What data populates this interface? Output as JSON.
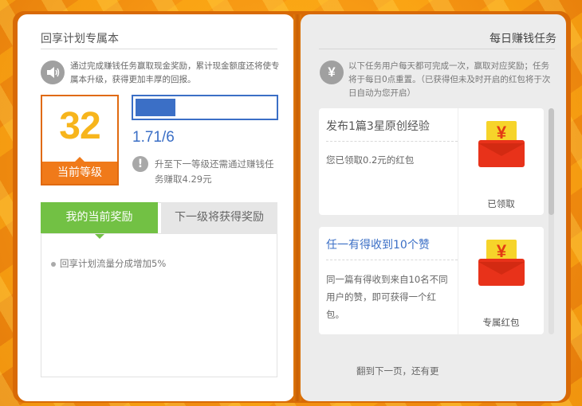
{
  "left_page": {
    "title": "回享计划专属本",
    "intro": "通过完成赚钱任务赢取现金奖励，累计现金额度还将使专属本升级，获得更加丰厚的回报。",
    "intro_icon": "speaker-icon",
    "level": {
      "number": "32",
      "label": "当前等级"
    },
    "progress": {
      "text": "1.71/6",
      "fraction": 0.285,
      "bar_color": "#3b6fc6"
    },
    "upgrade_hint": "升至下一等级还需通过赚钱任务赚取4.29元",
    "tabs": {
      "current": "我的当前奖励",
      "next": "下一级将获得奖励"
    },
    "rewards": [
      "回享计划流量分成增加5%"
    ]
  },
  "right_page": {
    "title": "每日赚钱任务",
    "intro": "以下任务用户每天都可完成一次，赢取对应奖励；任务将于每日0点重置。（已获得但未及时开启的红包将于次日自动为您开启）",
    "intro_icon": "yen-icon",
    "tasks": [
      {
        "title": "发布1篇3星原创经验",
        "desc": "您已领取0.2元的红包",
        "status": "已领取",
        "title_color": "#555555",
        "icon": "red-envelope-icon"
      },
      {
        "title": "任一有得收到10个赞",
        "desc": "同一篇有得收到来自10名不同用户的赞，即可获得一个红包。",
        "status": "专属红包",
        "title_color": "#3b6fc6",
        "icon": "red-envelope-icon"
      }
    ],
    "next_page_hint": "翻到下一页，还有更"
  },
  "colors": {
    "background": "#f08c10",
    "level_accent": "#f07a1a",
    "level_number": "#f7b51c",
    "tab_active": "#72c144",
    "envelope_red": "#e8321a",
    "envelope_note": "#f6d42a"
  }
}
